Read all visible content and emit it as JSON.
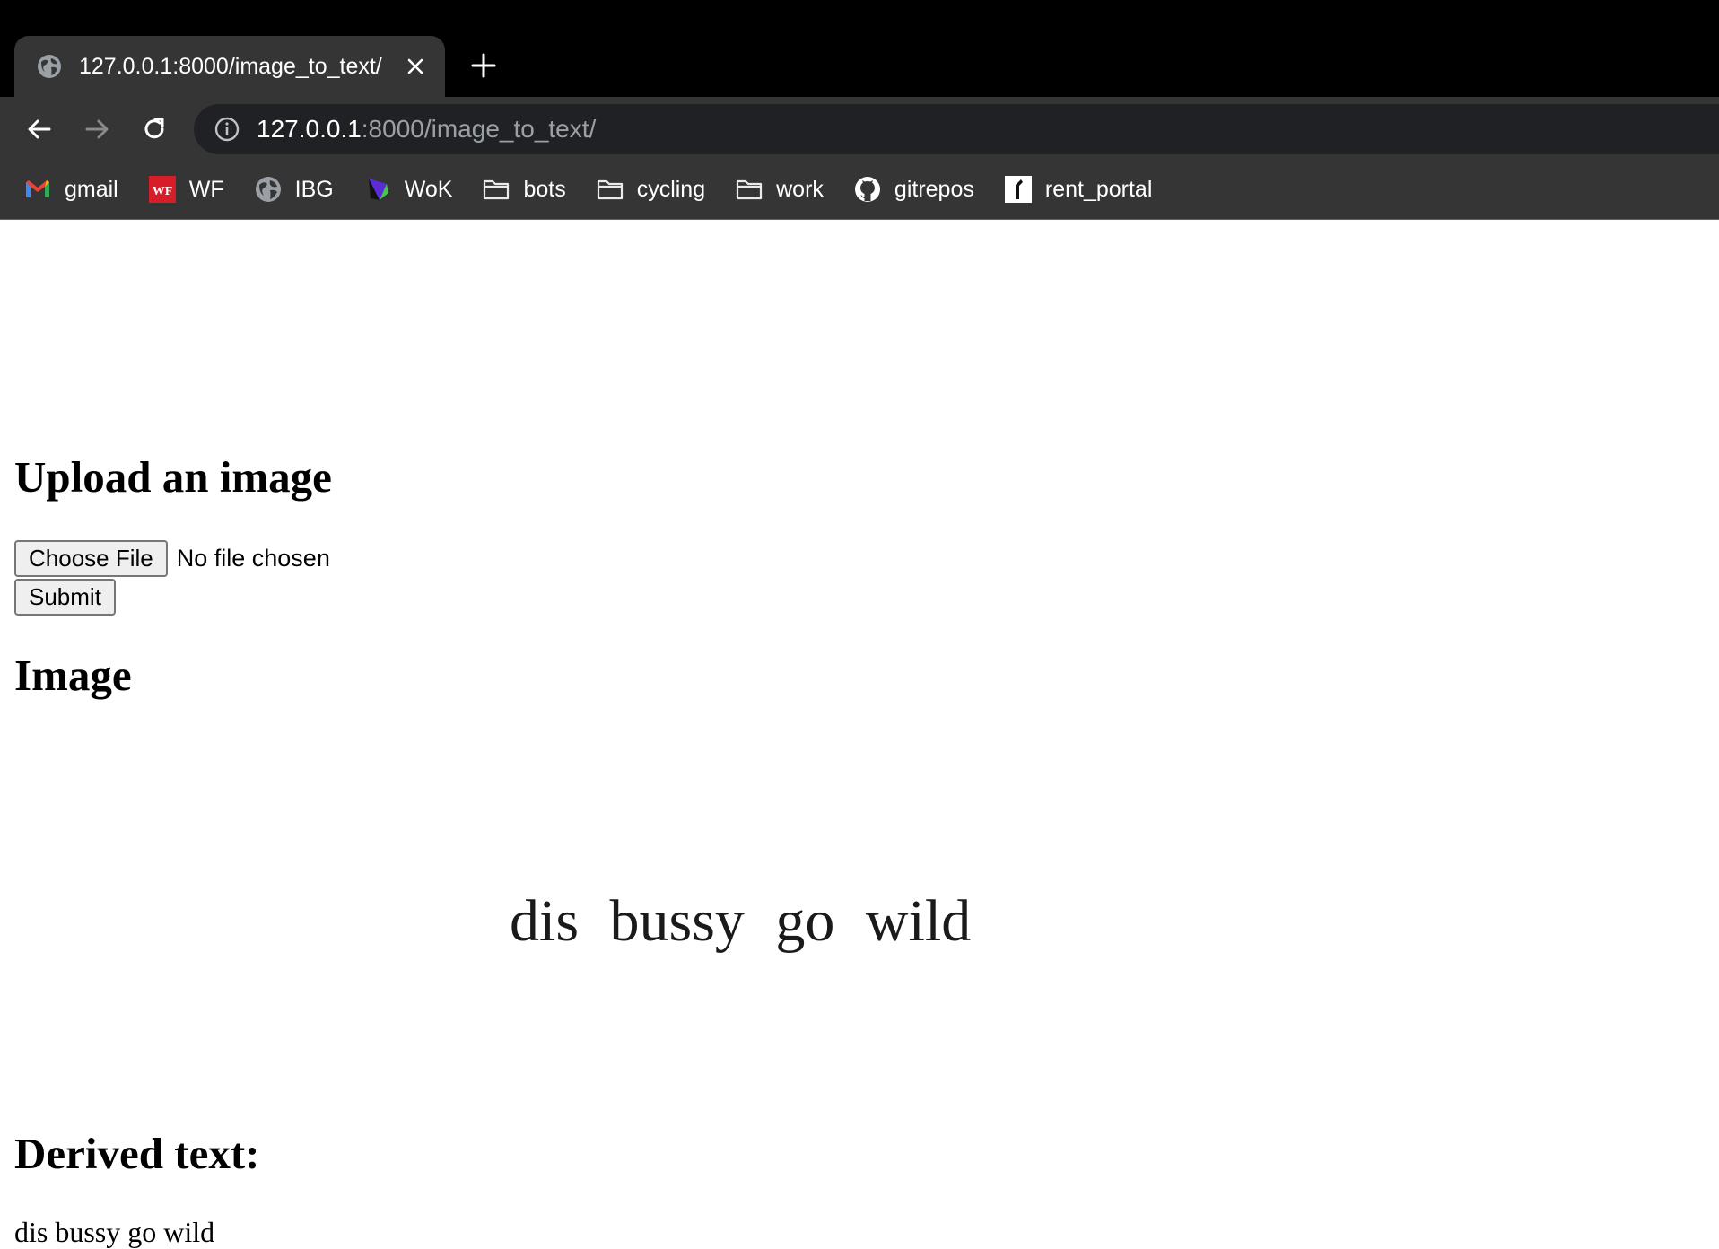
{
  "browser": {
    "tab": {
      "title": "127.0.0.1:8000/image_to_text/"
    },
    "address": {
      "host": "127.0.0.1",
      "path": ":8000/image_to_text/"
    },
    "bookmarks": [
      {
        "label": "gmail",
        "icon": "gmail-icon"
      },
      {
        "label": "WF",
        "icon": "wf-icon"
      },
      {
        "label": "IBG",
        "icon": "globe-icon"
      },
      {
        "label": "WoK",
        "icon": "wok-icon"
      },
      {
        "label": "bots",
        "icon": "folder-icon"
      },
      {
        "label": "cycling",
        "icon": "folder-icon"
      },
      {
        "label": "work",
        "icon": "folder-icon"
      },
      {
        "label": "gitrepos",
        "icon": "github-icon"
      },
      {
        "label": "rent_portal",
        "icon": "rent-portal-icon"
      }
    ]
  },
  "page": {
    "upload_heading": "Upload an image",
    "choose_file_label": "Choose File",
    "file_status": "No file chosen",
    "submit_label": "Submit",
    "image_heading": "Image",
    "image_text": "dis bussy go wild",
    "derived_heading": "Derived text:",
    "derived_text": "dis bussy go wild"
  },
  "colors": {
    "tabstrip": "#000000",
    "toolbar": "#353535",
    "omnibox": "#202124",
    "url_path": "#9aa0a6"
  }
}
